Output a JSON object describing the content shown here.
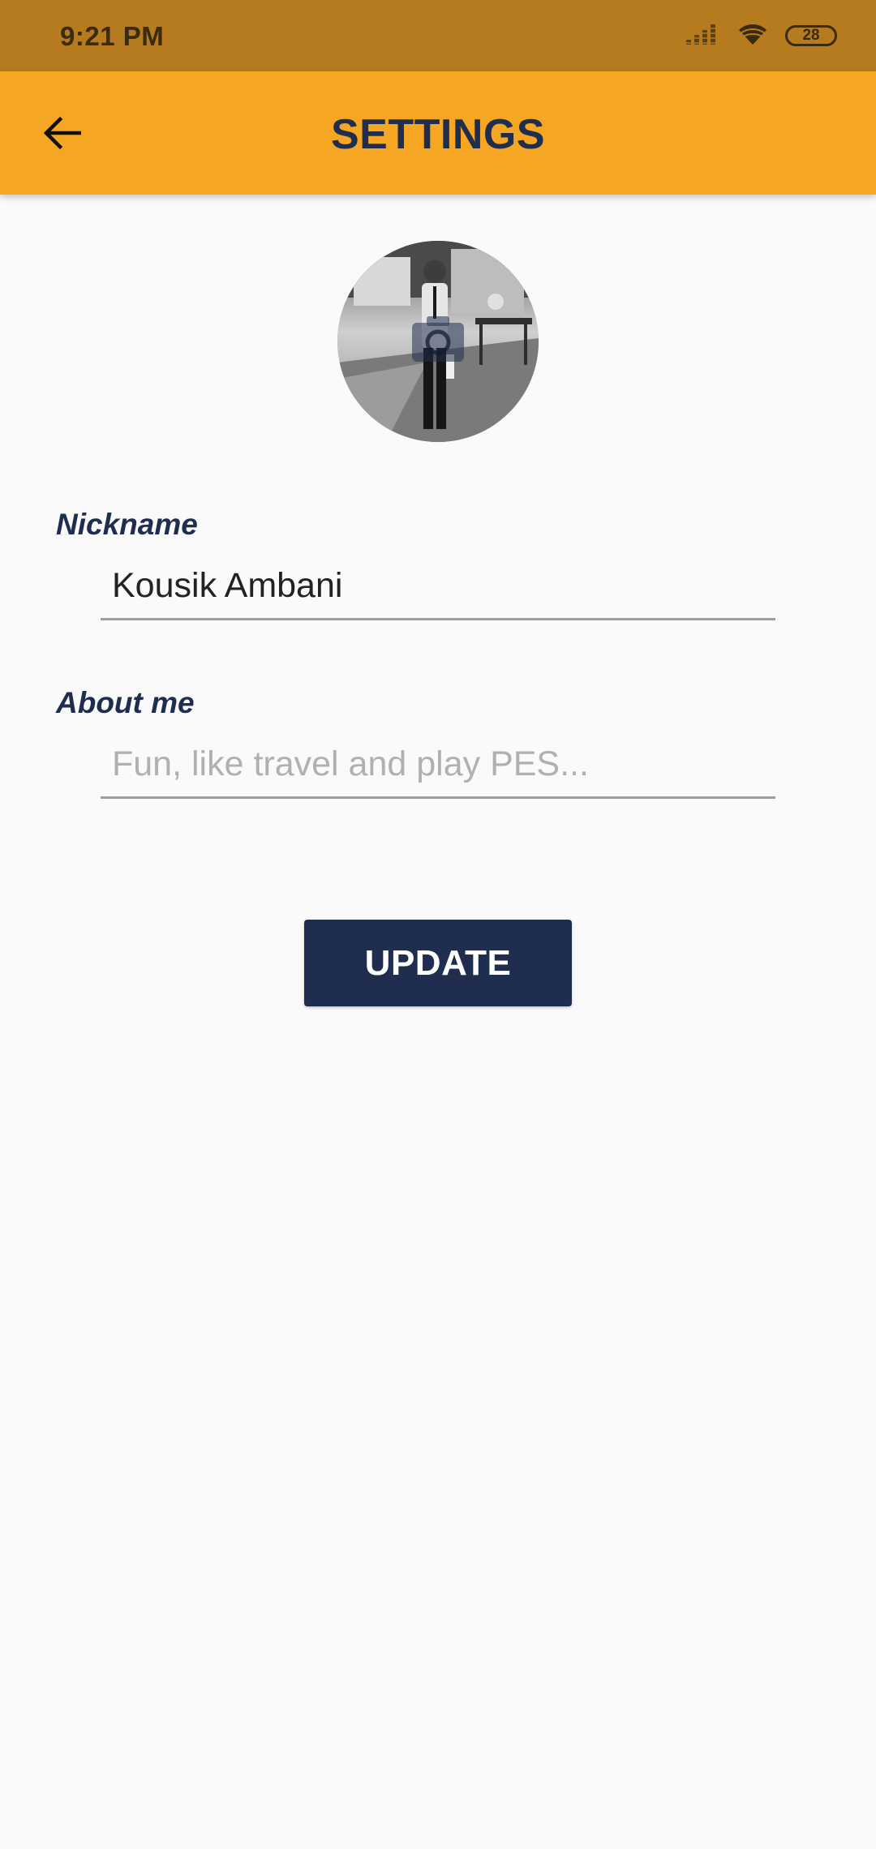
{
  "status_bar": {
    "time": "9:21 PM",
    "battery": "28",
    "icons": [
      "signal-icon",
      "wifi-icon",
      "battery-icon"
    ]
  },
  "app_bar": {
    "title": "SETTINGS",
    "back_icon": "arrow-left-icon"
  },
  "profile": {
    "avatar_icon": "camera-icon"
  },
  "form": {
    "nickname_label": "Nickname",
    "nickname_value": "Kousik Ambani",
    "about_label": "About me",
    "about_value": "",
    "about_placeholder": "Fun, like travel and play PES...",
    "update_label": "UPDATE"
  },
  "colors": {
    "status_bar": "#b67b1e",
    "app_bar": "#f5a623",
    "primary_dark": "#1f2d4e",
    "background": "#fafafa"
  }
}
